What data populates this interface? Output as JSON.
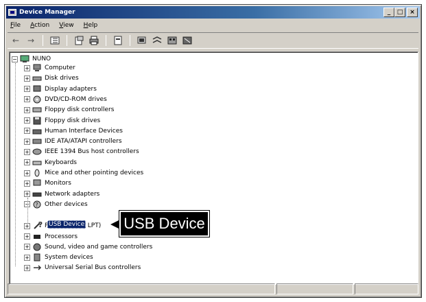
{
  "window": {
    "title": "Device Manager",
    "minimize_glyph": "_",
    "maximize_glyph": "□",
    "close_glyph": "×"
  },
  "menu": {
    "file": "File",
    "action": "Action",
    "view": "View",
    "help": "Help"
  },
  "toolbar": {
    "back_glyph": "←",
    "forward_glyph": "→"
  },
  "tree": {
    "root": "NUNO",
    "items": [
      {
        "label": "Computer",
        "icon": "computer-icon"
      },
      {
        "label": "Disk drives",
        "icon": "disk-icon"
      },
      {
        "label": "Display adapters",
        "icon": "display-icon"
      },
      {
        "label": "DVD/CD-ROM drives",
        "icon": "cdrom-icon"
      },
      {
        "label": "Floppy disk controllers",
        "icon": "controller-icon"
      },
      {
        "label": "Floppy disk drives",
        "icon": "floppy-icon"
      },
      {
        "label": "Human Interface Devices",
        "icon": "hid-icon"
      },
      {
        "label": "IDE ATA/ATAPI controllers",
        "icon": "ide-icon"
      },
      {
        "label": "IEEE 1394 Bus host controllers",
        "icon": "firewire-icon"
      },
      {
        "label": "Keyboards",
        "icon": "keyboard-icon"
      },
      {
        "label": "Mice and other pointing devices",
        "icon": "mouse-icon"
      },
      {
        "label": "Monitors",
        "icon": "monitor-icon"
      },
      {
        "label": "Network adapters",
        "icon": "network-icon"
      },
      {
        "label": "Other devices",
        "icon": "other-devices-icon"
      },
      {
        "label": "Ports (COM & LPT)",
        "icon": "port-icon"
      },
      {
        "label": "Processors",
        "icon": "processor-icon"
      },
      {
        "label": "Sound, video and game controllers",
        "icon": "sound-icon"
      },
      {
        "label": "System devices",
        "icon": "system-icon"
      },
      {
        "label": "Universal Serial Bus controllers",
        "icon": "usb-icon"
      }
    ],
    "child_usb": "USB Device",
    "expander_plus": "+",
    "expander_minus": "−"
  },
  "callout": {
    "text": "USB Device"
  }
}
